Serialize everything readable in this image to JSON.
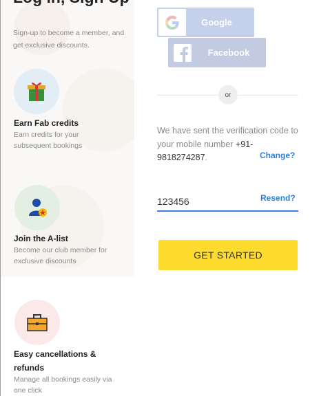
{
  "left": {
    "heading": "Log in, Sign Up",
    "subtext": "Sign-up to become a member, and get exclusive discounts.",
    "features": [
      {
        "icon": "gift-icon",
        "title": "Earn Fab credits",
        "desc": "Earn credits for your subsequent bookings"
      },
      {
        "icon": "member-star-icon",
        "title": "Join the A-list",
        "desc": "Become our club member for exclusive discounts"
      },
      {
        "icon": "briefcase-icon",
        "title": "Easy cancellations & refunds",
        "desc": "Manage all bookings easily via one click"
      }
    ]
  },
  "social": {
    "google_label": "Google",
    "facebook_label": "Facebook"
  },
  "divider_label": "or",
  "verification": {
    "message": "We have sent the verification code to your mobile number ",
    "phone": "+91-9818274287",
    "period": ".",
    "change_label": "Change?"
  },
  "otp": {
    "value": "123456",
    "resend_label": "Resend?"
  },
  "submit_label": "GET STARTED",
  "colors": {
    "accent_yellow": "#fddb2f",
    "link_blue": "#2f7fd5",
    "google_bg": "#c5d0ea",
    "facebook_bg": "#c3cbe2"
  }
}
